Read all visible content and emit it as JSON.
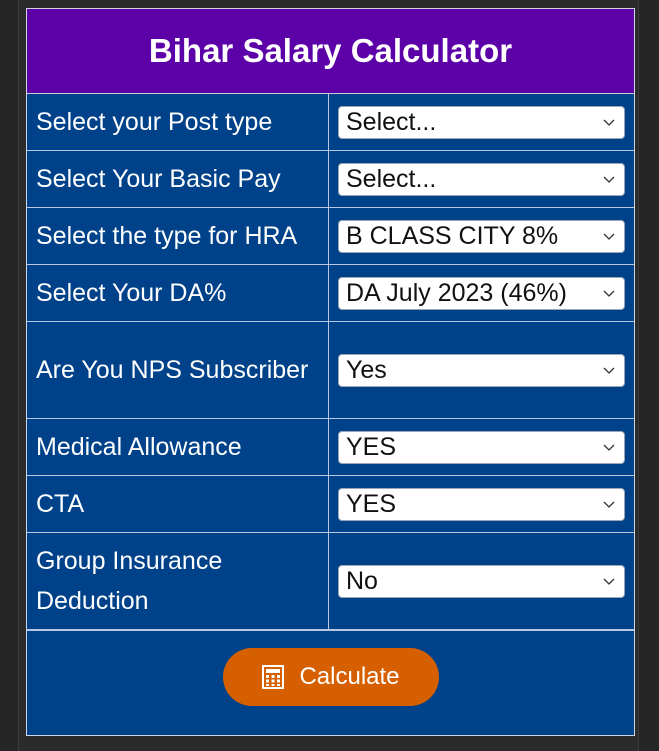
{
  "header": {
    "title": "Bihar Salary Calculator"
  },
  "rows": [
    {
      "label": "Select your Post type",
      "value": "Select..."
    },
    {
      "label": "Select Your Basic Pay",
      "value": "Select..."
    },
    {
      "label": "Select the type for HRA",
      "value": "B CLASS CITY 8%"
    },
    {
      "label": "Select Your DA%",
      "value": "DA July 2023 (46%)"
    },
    {
      "label": "Are You NPS Subscriber",
      "value": "Yes"
    },
    {
      "label": "Medical Allowance",
      "value": "YES"
    },
    {
      "label": "CTA",
      "value": "YES"
    },
    {
      "label": "Group Insurance Deduction",
      "value": "No"
    }
  ],
  "calculate_button": {
    "label": "Calculate",
    "icon": "calculator-icon"
  },
  "colors": {
    "header": "#5c00a8",
    "body": "#00428a",
    "button": "#d66000"
  }
}
